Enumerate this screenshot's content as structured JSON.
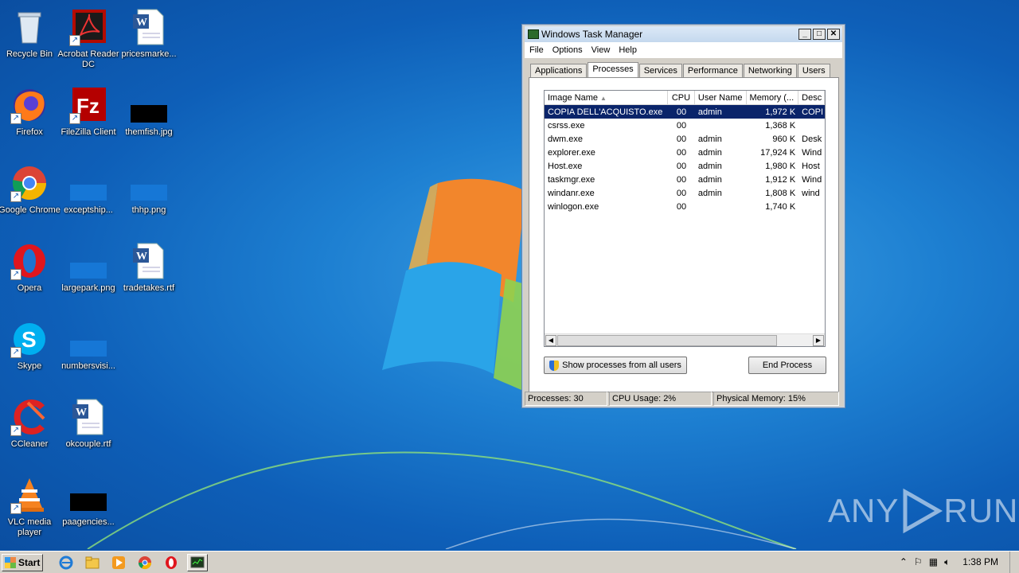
{
  "desktop": {
    "icons": [
      {
        "label": "Recycle Bin",
        "icon": "recycle-bin-icon"
      },
      {
        "label": "Acrobat Reader DC",
        "icon": "acrobat-icon"
      },
      {
        "label": "pricesmarke...",
        "icon": "word-document-icon"
      },
      {
        "label": "Firefox",
        "icon": "firefox-icon"
      },
      {
        "label": "FileZilla Client",
        "icon": "filezilla-icon"
      },
      {
        "label": "themfish.jpg",
        "icon": "image-file-icon"
      },
      {
        "label": "Google Chrome",
        "icon": "chrome-icon"
      },
      {
        "label": "exceptship...",
        "icon": "image-file-icon"
      },
      {
        "label": "thhp.png",
        "icon": "image-file-icon"
      },
      {
        "label": "Opera",
        "icon": "opera-icon"
      },
      {
        "label": "largepark.png",
        "icon": "image-file-icon"
      },
      {
        "label": "tradetakes.rtf",
        "icon": "word-document-icon"
      },
      {
        "label": "Skype",
        "icon": "skype-icon"
      },
      {
        "label": "numbersvisi...",
        "icon": "image-file-icon"
      },
      {
        "label": "CCleaner",
        "icon": "ccleaner-icon"
      },
      {
        "label": "okcouple.rtf",
        "icon": "word-document-icon"
      },
      {
        "label": "VLC media player",
        "icon": "vlc-icon"
      },
      {
        "label": "paagencies...",
        "icon": "image-file-icon"
      }
    ]
  },
  "task_manager": {
    "title": "Windows Task Manager",
    "menu": [
      "File",
      "Options",
      "View",
      "Help"
    ],
    "tabs": [
      "Applications",
      "Processes",
      "Services",
      "Performance",
      "Networking",
      "Users"
    ],
    "active_tab": "Processes",
    "columns": [
      "Image Name",
      "CPU",
      "User Name",
      "Memory (...",
      "Desc"
    ],
    "rows": [
      {
        "name": "COPIA DELL'ACQUISTO.exe",
        "cpu": "00",
        "user": "admin",
        "mem": "1,972 K",
        "desc": "COPI"
      },
      {
        "name": "csrss.exe",
        "cpu": "00",
        "user": "",
        "mem": "1,368 K",
        "desc": ""
      },
      {
        "name": "dwm.exe",
        "cpu": "00",
        "user": "admin",
        "mem": "960 K",
        "desc": "Desk"
      },
      {
        "name": "explorer.exe",
        "cpu": "00",
        "user": "admin",
        "mem": "17,924 K",
        "desc": "Wind"
      },
      {
        "name": "Host.exe",
        "cpu": "00",
        "user": "admin",
        "mem": "1,980 K",
        "desc": "Host"
      },
      {
        "name": "taskmgr.exe",
        "cpu": "00",
        "user": "admin",
        "mem": "1,912 K",
        "desc": "Wind"
      },
      {
        "name": "windanr.exe",
        "cpu": "00",
        "user": "admin",
        "mem": "1,808 K",
        "desc": "wind"
      },
      {
        "name": "winlogon.exe",
        "cpu": "00",
        "user": "",
        "mem": "1,740 K",
        "desc": ""
      }
    ],
    "show_all_label": "Show processes from all users",
    "end_process_label": "End Process",
    "status": {
      "processes": "Processes: 30",
      "cpu": "CPU Usage: 2%",
      "memory": "Physical Memory: 15%"
    }
  },
  "taskbar": {
    "start_label": "Start",
    "clock": "1:38 PM"
  },
  "watermark": {
    "left": "ANY",
    "right": "RUN"
  }
}
